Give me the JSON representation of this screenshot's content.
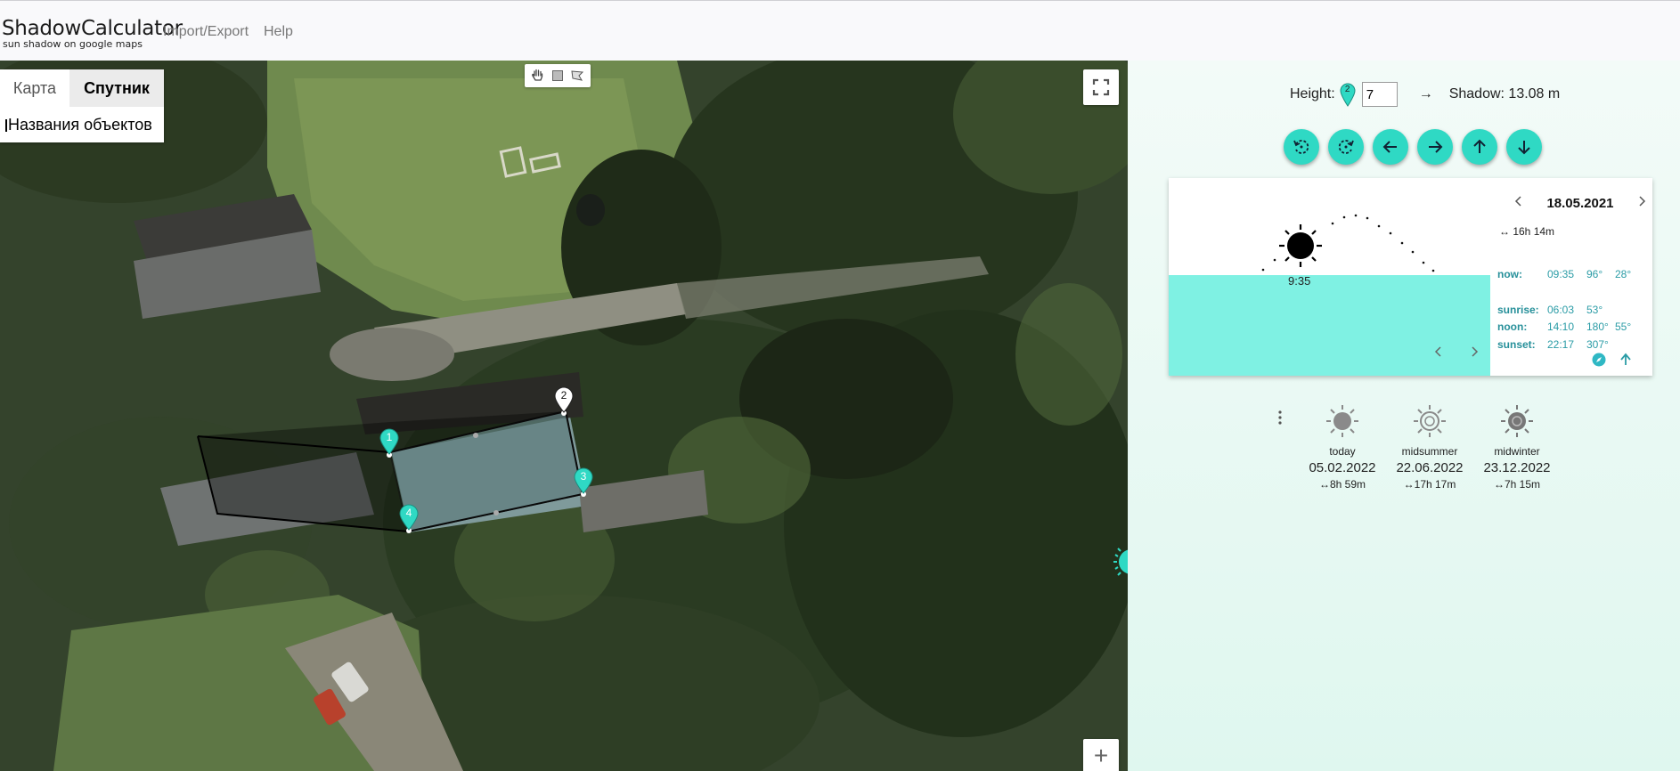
{
  "header": {
    "title": "ShadowCalculator",
    "subtitle": "sun shadow on google maps",
    "nav": [
      "Import/Export",
      "Help"
    ]
  },
  "map": {
    "type_buttons": [
      "Карта",
      "Спутник"
    ],
    "selected_type": "Спутник",
    "labels_option": "Названия объектов",
    "draw_tools": [
      "hand-icon",
      "rectangle-icon",
      "polygon-icon"
    ],
    "markers": [
      "1",
      "2",
      "3",
      "4"
    ],
    "zoom_in": "+"
  },
  "controls": {
    "height_label": "Height:",
    "height_value": "7",
    "marker_badge": "2",
    "arrow": "→",
    "shadow_text": "Shadow: 13.08 m",
    "buttons": [
      "rotate-left-icon",
      "rotate-right-icon",
      "arrow-left-icon",
      "arrow-right-icon",
      "arrow-up-icon",
      "arrow-down-icon"
    ]
  },
  "sun_card": {
    "date": "18.05.2021",
    "day_length": "↔ 16h 14m",
    "current_time": "9:35",
    "rows": [
      {
        "label": "now:",
        "time": "09:35",
        "azimuth": "96°",
        "altitude": "28°"
      },
      {
        "label": "sunrise:",
        "time": "06:03",
        "azimuth": "53°",
        "altitude": ""
      },
      {
        "label": "noon:",
        "time": "14:10",
        "azimuth": "180°",
        "altitude": "55°"
      },
      {
        "label": "sunset:",
        "time": "22:17",
        "azimuth": "307°",
        "altitude": ""
      }
    ],
    "accent_color": "#2fd9c4",
    "water_color": "#7ff1e3"
  },
  "presets": [
    {
      "name": "today",
      "date": "05.02.2022",
      "length": "↔8h 59m"
    },
    {
      "name": "midsummer",
      "date": "22.06.2022",
      "length": "↔17h 17m"
    },
    {
      "name": "midwinter",
      "date": "23.12.2022",
      "length": "↔7h 15m"
    }
  ]
}
